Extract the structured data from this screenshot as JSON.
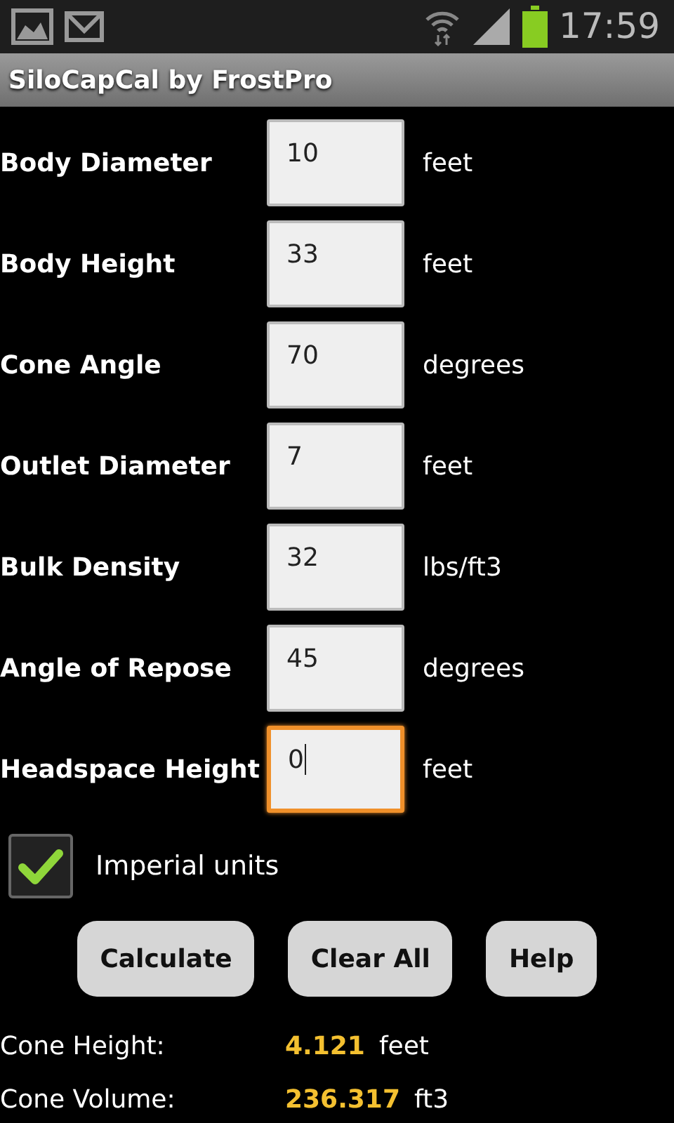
{
  "status_bar": {
    "time": "17:59"
  },
  "title": "SiloCapCal by FrostPro",
  "fields": [
    {
      "label": "Body Diameter",
      "value": "10",
      "unit": "feet",
      "focused": false
    },
    {
      "label": "Body Height",
      "value": "33",
      "unit": "feet",
      "focused": false
    },
    {
      "label": "Cone Angle",
      "value": "70",
      "unit": "degrees",
      "focused": false
    },
    {
      "label": "Outlet Diameter",
      "value": "7",
      "unit": "feet",
      "focused": false
    },
    {
      "label": "Bulk Density",
      "value": "32",
      "unit": "lbs/ft3",
      "focused": false
    },
    {
      "label": "Angle of Repose",
      "value": "45",
      "unit": "degrees",
      "focused": false
    },
    {
      "label": "Headspace Height",
      "value": "0",
      "unit": "feet",
      "focused": true
    }
  ],
  "checkbox": {
    "label": "Imperial units",
    "checked": true
  },
  "buttons": [
    "Calculate",
    "Clear All",
    "Help"
  ],
  "results": [
    {
      "label": "Cone Height:",
      "value": "4.121",
      "unit": "feet"
    },
    {
      "label": "Cone Volume:",
      "value": "236.317",
      "unit": "ft3"
    }
  ]
}
